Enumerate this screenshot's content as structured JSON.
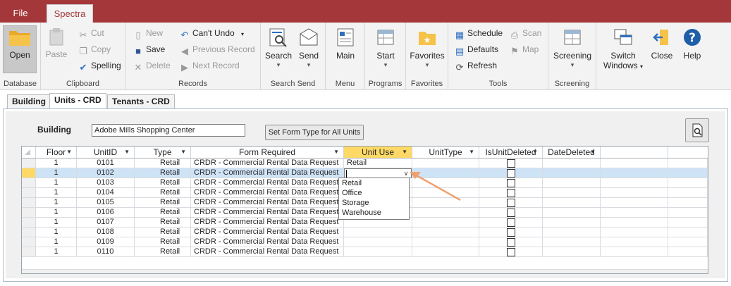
{
  "tabs": {
    "file": "File",
    "spectra": "Spectra"
  },
  "ribbon": {
    "database": {
      "label": "Database",
      "open": "Open"
    },
    "clipboard": {
      "label": "Clipboard",
      "paste": "Paste",
      "cut": "Cut",
      "copy": "Copy",
      "spelling": "Spelling"
    },
    "records": {
      "label": "Records",
      "new": "New",
      "save": "Save",
      "delete": "Delete",
      "cant_undo": "Can't Undo",
      "previous_record": "Previous Record",
      "next_record": "Next Record"
    },
    "search_send": {
      "label": "Search Send",
      "search": "Search",
      "send": "Send"
    },
    "menu": {
      "label": "Menu",
      "main": "Main"
    },
    "programs": {
      "label": "Programs",
      "start": "Start"
    },
    "favorites": {
      "label": "Favorites",
      "favorites": "Favorites"
    },
    "tools": {
      "label": "Tools",
      "schedule": "Schedule",
      "scan": "Scan",
      "defaults": "Defaults",
      "map": "Map",
      "refresh": "Refresh"
    },
    "screening": {
      "label": "Screening",
      "screening": "Screening"
    },
    "window": {
      "switch_windows_1": "Switch",
      "switch_windows_2": "Windows",
      "close": "Close",
      "help": "Help"
    }
  },
  "page_tabs": [
    "Building",
    "Units - CRD",
    "Tenants - CRD"
  ],
  "form": {
    "building_label": "Building",
    "building_value": "Adobe Mills Shopping Center",
    "set_form_button": "Set Form Type for All Units"
  },
  "grid": {
    "columns": [
      "Floor",
      "UnitID",
      "Type",
      "Form Required",
      "Unit Use",
      "UnitType",
      "IsUnitDeleted",
      "DateDeleted"
    ],
    "rows": [
      {
        "floor": "1",
        "unit_id": "0101",
        "type": "Retail",
        "form": "CRDR - Commercial Rental Data Request",
        "unit_use": "Retail"
      },
      {
        "floor": "1",
        "unit_id": "0102",
        "type": "Retail",
        "form": "CRDR - Commercial Rental Data Request",
        "unit_use": ""
      },
      {
        "floor": "1",
        "unit_id": "0103",
        "type": "Retail",
        "form": "CRDR - Commercial Rental Data Request",
        "unit_use": ""
      },
      {
        "floor": "1",
        "unit_id": "0104",
        "type": "Retail",
        "form": "CRDR - Commercial Rental Data Request",
        "unit_use": ""
      },
      {
        "floor": "1",
        "unit_id": "0105",
        "type": "Retail",
        "form": "CRDR - Commercial Rental Data Request",
        "unit_use": ""
      },
      {
        "floor": "1",
        "unit_id": "0106",
        "type": "Retail",
        "form": "CRDR - Commercial Rental Data Request",
        "unit_use": ""
      },
      {
        "floor": "1",
        "unit_id": "0107",
        "type": "Retail",
        "form": "CRDR - Commercial Rental Data Request",
        "unit_use": ""
      },
      {
        "floor": "1",
        "unit_id": "0108",
        "type": "Retail",
        "form": "CRDR - Commercial Rental Data Request",
        "unit_use": ""
      },
      {
        "floor": "1",
        "unit_id": "0109",
        "type": "Retail",
        "form": "CRDR - Commercial Rental Data Request",
        "unit_use": ""
      },
      {
        "floor": "1",
        "unit_id": "0110",
        "type": "Retail",
        "form": "CRDR - Commercial Rental Data Request",
        "unit_use": ""
      }
    ],
    "unit_use_options": [
      "Retail",
      "Office",
      "Storage",
      "Warehouse"
    ]
  },
  "colors": {
    "brand": "#a4373a",
    "header_highlight": "#ffd966",
    "row_selected": "#cfe3f7",
    "annotation_arrow": "#f0a070"
  }
}
